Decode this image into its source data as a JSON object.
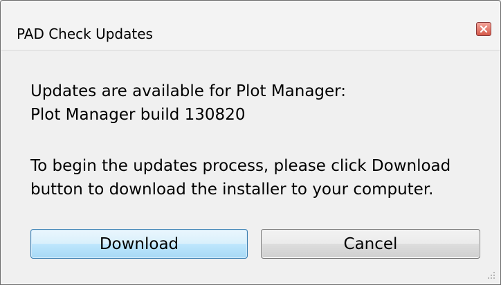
{
  "window": {
    "title": "PAD Check Updates",
    "close_icon": "close-icon"
  },
  "message": {
    "line1": "Updates are available for Plot Manager:",
    "line2": "Plot Manager build 130820",
    "line3": "To begin the updates process, please click Download",
    "line4": "button to download the installer to your computer."
  },
  "buttons": {
    "download_label": "Download",
    "cancel_label": "Cancel"
  },
  "colors": {
    "close_button": "#d55a4a",
    "default_button_border": "#3c7fb1"
  }
}
